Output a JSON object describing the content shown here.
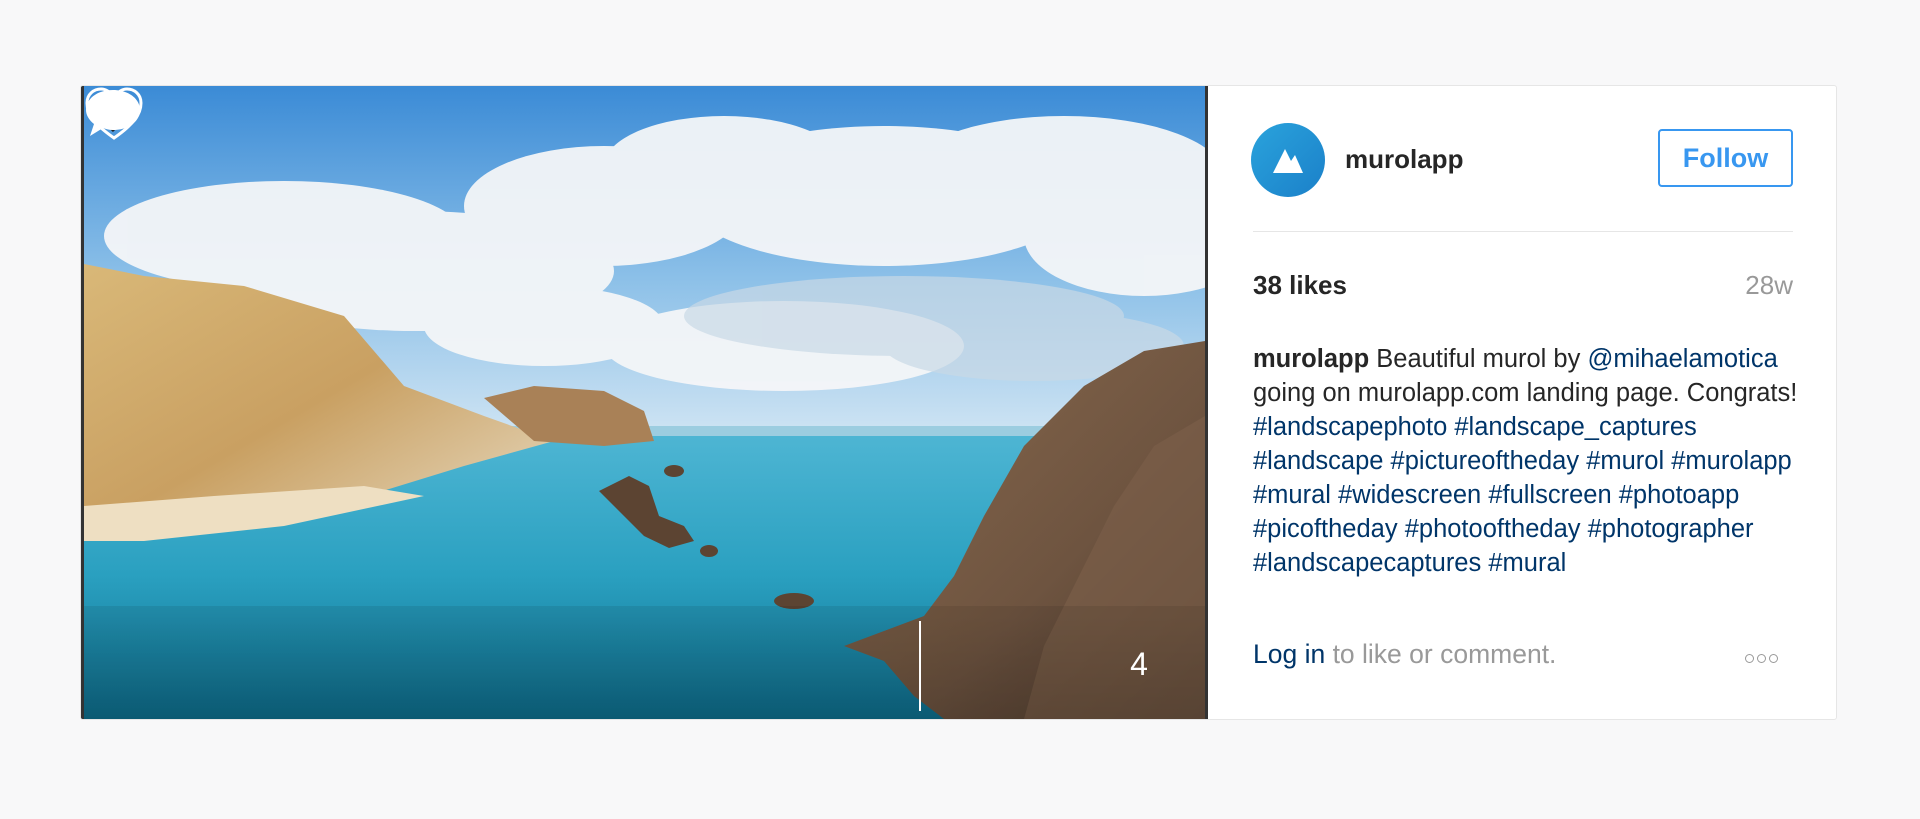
{
  "post": {
    "username": "murolapp",
    "follow_label": "Follow",
    "likes": "38 likes",
    "time_ago": "28w",
    "caption_user": "murolapp",
    "caption_text_1": " Beautiful murol by ",
    "caption_mention": "@mihaelamotica",
    "caption_text_2": " going on murolapp.com landing page. Congrats! ",
    "hashtags": [
      "#landscapephoto",
      "#landscape_captures",
      "#landscape",
      "#pictureoftheday",
      "#murol",
      "#murolapp",
      "#mural",
      "#widescreen",
      "#fullscreen",
      "#photoapp",
      "#picoftheday",
      "#photooftheday",
      "#photographer",
      "#landscapecaptures",
      "#mural"
    ],
    "comment_count": "4"
  },
  "footer": {
    "login_link": "Log in",
    "login_suffix": " to like or comment."
  },
  "icons": {
    "back": "chevron-left-icon",
    "like": "heart-icon",
    "comment": "speech-bubble-icon",
    "more": "more-options-icon",
    "avatar": "mountain-logo"
  },
  "colors": {
    "link": "#003569",
    "follow": "#3897f0",
    "avatar": "#1b8fd6"
  }
}
